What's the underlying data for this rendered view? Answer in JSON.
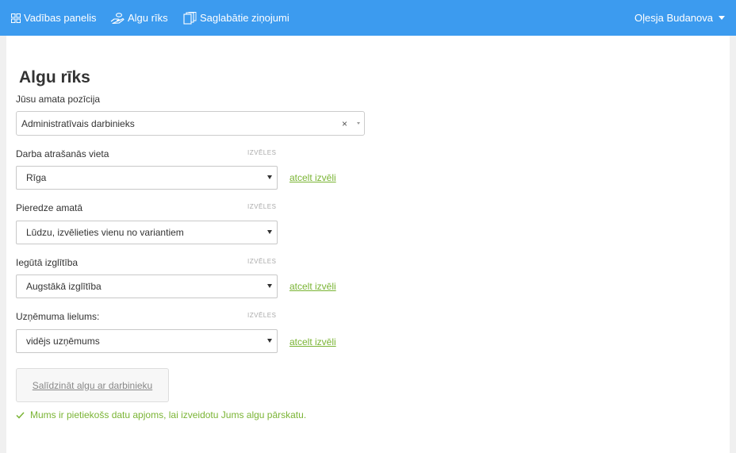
{
  "nav": {
    "items": [
      {
        "label": "Vadības panelis",
        "icon": "grid-icon"
      },
      {
        "label": "Algu rīks",
        "icon": "hand-coins-icon"
      },
      {
        "label": "Saglabātie ziņojumi",
        "icon": "documents-icon"
      }
    ],
    "user_name": "Oļesja Budanova"
  },
  "page": {
    "title": "Algu rīks"
  },
  "form": {
    "position": {
      "label": "Jūsu amata pozīcija",
      "value": "Administratīvais darbinieks"
    },
    "location": {
      "label": "Darba atrašanās vieta",
      "optional": "IZVĒLES",
      "value": "Rīga",
      "clear_label": "atcelt izvēli"
    },
    "experience": {
      "label": "Pieredze amatā",
      "optional": "IZVĒLES",
      "value": "Lūdzu, izvēlieties vienu no variantiem"
    },
    "education": {
      "label": "Iegūtā izglītība",
      "optional": "IZVĒLES",
      "value": "Augstākā izglītība",
      "clear_label": "atcelt izvēli"
    },
    "company_size": {
      "label": "Uzņēmuma lielums:",
      "optional": "IZVĒLES",
      "value": "vidējs uzņēmums",
      "clear_label": "atcelt izvēli"
    },
    "compare_button": "Salīdzināt algu ar darbinieku",
    "status_message": "Mums ir pietiekošs datu apjoms, lai izveidotu Jums algu pārskatu."
  },
  "colors": {
    "topbar": "#3c9bef",
    "link_green": "#7ab434"
  }
}
